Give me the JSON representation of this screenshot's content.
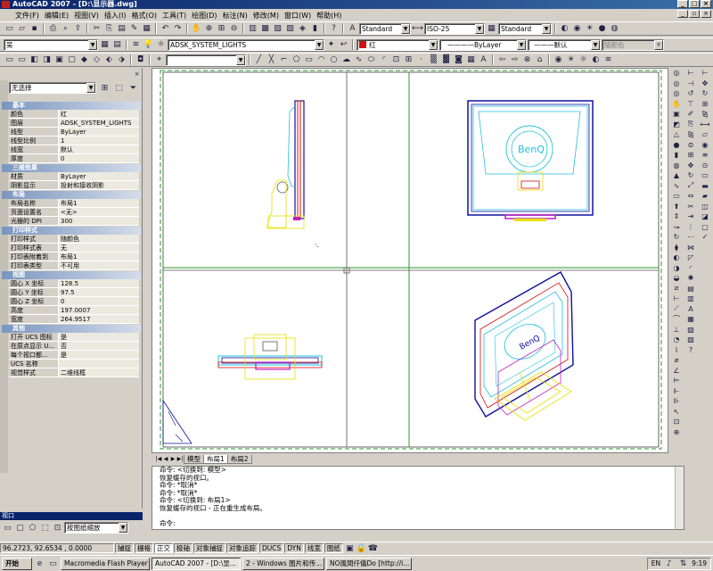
{
  "window": {
    "title": "AutoCAD 2007 - [D:\\显示器.dwg]"
  },
  "menu": [
    "文件(F)",
    "编辑(E)",
    "视图(V)",
    "插入(I)",
    "格式(O)",
    "工具(T)",
    "绘图(D)",
    "标注(N)",
    "修改(M)",
    "窗口(W)",
    "帮助(H)"
  ],
  "toolbar1": {
    "text_style": "Standard",
    "dim_style": "ISO-25",
    "table_style": "Standard"
  },
  "toolbar2": {
    "workspace": "吴",
    "layer": "ADSK_SYSTEM_LIGHTS",
    "color": "红",
    "linetype": "ByLayer",
    "lineweight": "默认",
    "plotstyle": "随颜色"
  },
  "palette": {
    "selection": "无选择",
    "sections": [
      {
        "title": "基本",
        "rows": [
          [
            "颜色",
            "红"
          ],
          [
            "图层",
            "ADSK_SYSTEM_LIGHTS"
          ],
          [
            "线型",
            "ByLayer"
          ],
          [
            "线型比例",
            "1"
          ],
          [
            "线宽",
            "默认"
          ],
          [
            "厚度",
            "0"
          ]
        ]
      },
      {
        "title": "三维效果",
        "rows": [
          [
            "材质",
            "ByLayer"
          ],
          [
            "阴影显示",
            "投射和接收阴影"
          ]
        ]
      },
      {
        "title": "布局",
        "rows": [
          [
            "布局名称",
            "布局1"
          ],
          [
            "页面设置名",
            "<无>"
          ],
          [
            "光栅的 DPI",
            "300"
          ]
        ]
      },
      {
        "title": "打印样式",
        "rows": [
          [
            "打印样式",
            "随颜色"
          ],
          [
            "打印样式表",
            "无"
          ],
          [
            "打印表附着到",
            "布局1"
          ],
          [
            "打印表类型",
            "不可用"
          ]
        ]
      },
      {
        "title": "视图",
        "rows": [
          [
            "圆心 X 坐标",
            "128.5"
          ],
          [
            "圆心 Y 坐标",
            "97.5"
          ],
          [
            "圆心 Z 坐标",
            "0"
          ],
          [
            "高度",
            "197.0007"
          ],
          [
            "宽度",
            "264.9517"
          ]
        ]
      },
      {
        "title": "其他",
        "rows": [
          [
            "打开 UCS 图标",
            "是"
          ],
          [
            "在原点显示 U...",
            "否"
          ],
          [
            "每个视口都...",
            "是"
          ],
          [
            "UCS 名称",
            ""
          ],
          [
            "视觉样式",
            "二维线框"
          ]
        ]
      }
    ]
  },
  "layout_tabs": [
    "模型",
    "布局1",
    "布局2"
  ],
  "active_tab": "布局1",
  "command_lines": [
    "命令: <切换到: 模型>",
    "恢复缓存的视口。",
    "命令: *取消*",
    "命令: *取消*",
    "命令: <切换到: 布局1>",
    "恢复缓存的视口 - 正在重生成布局。",
    "",
    "命令:"
  ],
  "viewport_panel": {
    "title": "视口",
    "scale": "按图纸缩放"
  },
  "status": {
    "coords": "96.2723,  92.6534 , 0.0000",
    "toggles": [
      "捕捉",
      "栅格",
      "正交",
      "极轴",
      "对象捕捉",
      "对象追踪",
      "DUCS",
      "DYN",
      "线宽",
      "图纸"
    ],
    "active_toggle": "正交"
  },
  "taskbar": {
    "start": "开始",
    "items": [
      "Macromedia Flash Player 8",
      "AutoCAD 2007 - [D:\\显...",
      "2 - Windows 图片和传...",
      "NO風間仟儀Do [http://i..."
    ],
    "active": "AutoCAD 2007 - [D:\\显...",
    "lang": "EN",
    "time": "9:19"
  },
  "drawing_text": {
    "brand": "BenQ"
  },
  "colors": {
    "frame": "#2a9a2a",
    "monitor_blue": "#1010a0",
    "cyan": "#20c0e0",
    "magenta": "#c020c0",
    "yellow": "#e8e000",
    "red": "#d01010"
  }
}
